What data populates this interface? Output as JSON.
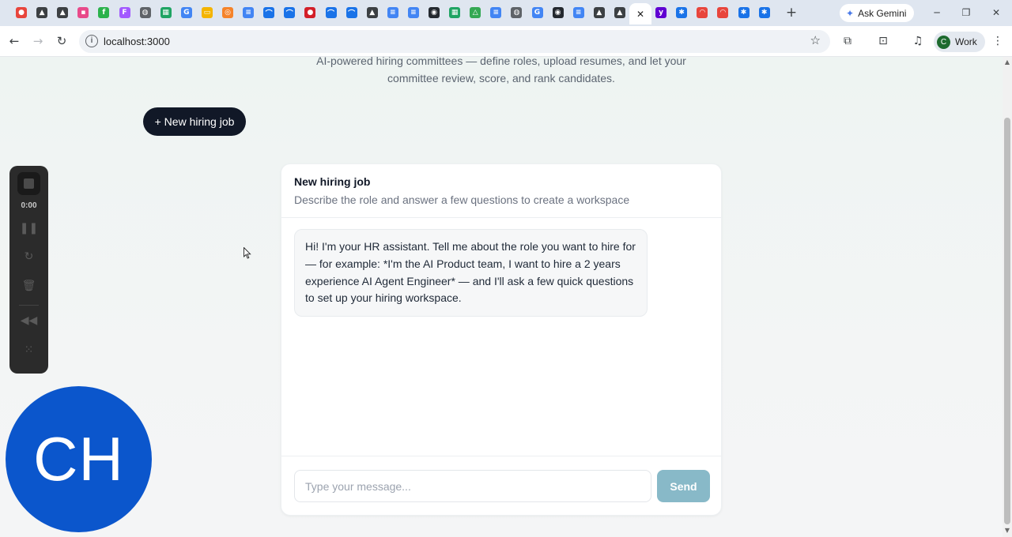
{
  "browser": {
    "tabs": [
      {
        "name": "tab-recorder",
        "color": "#e8453c",
        "glyph": "●"
      },
      {
        "name": "tab-app-1",
        "color": "#3c4043",
        "glyph": "▲"
      },
      {
        "name": "tab-app-2",
        "color": "#3c4043",
        "glyph": "▲"
      },
      {
        "name": "tab-app-3",
        "color": "#e84a8a",
        "glyph": "▪"
      },
      {
        "name": "tab-feedly",
        "color": "#2bb24c",
        "glyph": "f"
      },
      {
        "name": "tab-figma",
        "color": "#a259ff",
        "glyph": "F"
      },
      {
        "name": "tab-web-1",
        "color": "#5f6368",
        "glyph": "◍"
      },
      {
        "name": "tab-sheets-1",
        "color": "#1fa463",
        "glyph": "▦"
      },
      {
        "name": "tab-google-1",
        "color": "#4285f4",
        "glyph": "G"
      },
      {
        "name": "tab-slides-1",
        "color": "#f4b400",
        "glyph": "▭"
      },
      {
        "name": "tab-app-4",
        "color": "#f5832a",
        "glyph": "◎"
      },
      {
        "name": "tab-docs-1",
        "color": "#4285f4",
        "glyph": "≡"
      },
      {
        "name": "tab-app-5",
        "color": "#1a73e8",
        "glyph": "⌒"
      },
      {
        "name": "tab-app-6",
        "color": "#1a73e8",
        "glyph": "⌒"
      },
      {
        "name": "tab-app-7",
        "color": "#d3202a",
        "glyph": "●"
      },
      {
        "name": "tab-app-8",
        "color": "#1a73e8",
        "glyph": "⌒"
      },
      {
        "name": "tab-app-9",
        "color": "#1a73e8",
        "glyph": "⌒"
      },
      {
        "name": "tab-app-10",
        "color": "#3c4043",
        "glyph": "▲"
      },
      {
        "name": "tab-docs-2",
        "color": "#4285f4",
        "glyph": "≡"
      },
      {
        "name": "tab-docs-3",
        "color": "#4285f4",
        "glyph": "≡"
      },
      {
        "name": "tab-github-1",
        "color": "#24292f",
        "glyph": "◉"
      },
      {
        "name": "tab-sheets-2",
        "color": "#1fa463",
        "glyph": "▦"
      },
      {
        "name": "tab-drive",
        "color": "#34a853",
        "glyph": "△"
      },
      {
        "name": "tab-docs-4",
        "color": "#4285f4",
        "glyph": "≡"
      },
      {
        "name": "tab-web-2",
        "color": "#5f6368",
        "glyph": "◍"
      },
      {
        "name": "tab-google-2",
        "color": "#4285f4",
        "glyph": "G"
      },
      {
        "name": "tab-github-2",
        "color": "#24292f",
        "glyph": "◉"
      },
      {
        "name": "tab-docs-5",
        "color": "#4285f4",
        "glyph": "≡"
      },
      {
        "name": "tab-app-11",
        "color": "#3c4043",
        "glyph": "▲"
      },
      {
        "name": "tab-app-12",
        "color": "#3c4043",
        "glyph": "▲"
      },
      {
        "name": "tab-active",
        "color": "#1f1f1f",
        "glyph": "✕"
      },
      {
        "name": "tab-yahoo",
        "color": "#6001d2",
        "glyph": "y"
      },
      {
        "name": "tab-app-13",
        "color": "#1a73e8",
        "glyph": "✱"
      },
      {
        "name": "tab-app-14",
        "color": "#e8453c",
        "glyph": "◠"
      },
      {
        "name": "tab-app-15",
        "color": "#e8453c",
        "glyph": "◠"
      },
      {
        "name": "tab-app-16",
        "color": "#1a73e8",
        "glyph": "✱"
      },
      {
        "name": "tab-app-17",
        "color": "#1a73e8",
        "glyph": "✱"
      }
    ],
    "ask_gemini": "Ask Gemini",
    "url": "localhost:3000",
    "profile_initial": "C",
    "profile_label": "Work"
  },
  "page": {
    "subtitle": "AI-powered hiring committees — define roles, upload resumes, and let your committee review, score, and rank candidates.",
    "new_job_button": "+ New hiring job",
    "card": {
      "title": "New hiring job",
      "description": "Describe the role and answer a few questions to create a workspace",
      "assistant_message": "Hi! I'm your HR assistant. Tell me about the role you want to hire for — for example: *I'm the AI Product team, I want to hire a 2 years experience AI Agent Engineer* — and I'll ask a few quick questions to set up your hiring workspace.",
      "input_placeholder": "Type your message...",
      "send_label": "Send"
    }
  },
  "recorder": {
    "time": "0:00"
  },
  "webcam": {
    "initials": "CH"
  }
}
